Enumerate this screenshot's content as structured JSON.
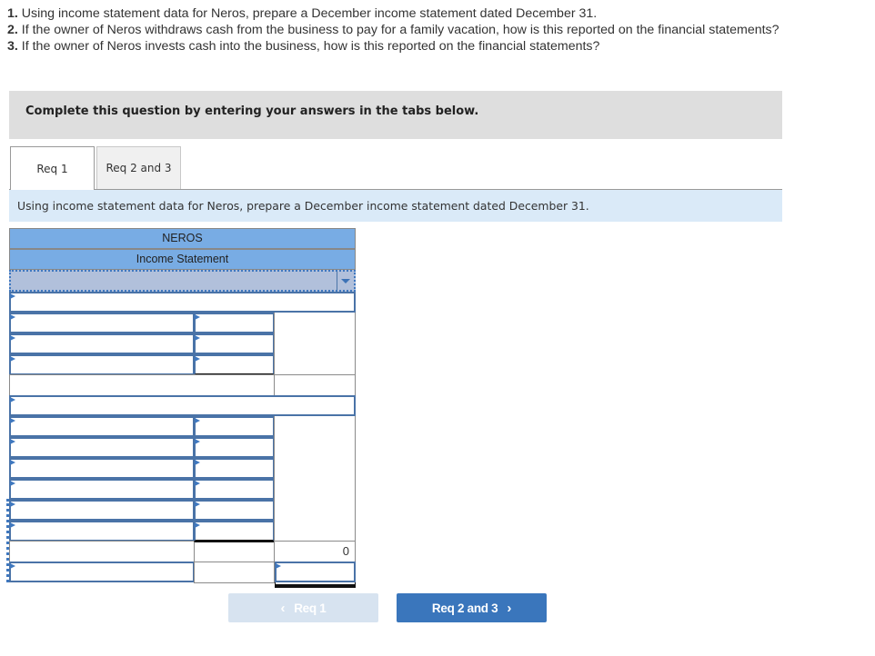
{
  "questions": [
    {
      "num": "1.",
      "text": " Using income statement data for Neros, prepare a December income statement dated December 31."
    },
    {
      "num": "2.",
      "text": " If the owner of Neros withdraws cash from the business to pay for a family vacation, how is this reported on the financial statements?"
    },
    {
      "num": "3.",
      "text": " If the owner of Neros invests cash into the business, how is this reported on the financial statements?"
    }
  ],
  "banner": {
    "text": "Complete this question by entering your answers in the tabs below."
  },
  "tabs": [
    {
      "label": "Req 1",
      "active": true
    },
    {
      "label": "Req 2 and 3",
      "active": false
    }
  ],
  "instruction": "Using income statement data for Neros, prepare a December income statement dated December 31.",
  "statement": {
    "company": "NEROS",
    "title": "Income Statement",
    "date_dropdown": {
      "selected": "",
      "options_visible": false
    },
    "total_value": "0"
  },
  "nav": {
    "prev": {
      "label": "Req 1",
      "icon": "chevron-left-icon",
      "glyph": "‹",
      "disabled": true
    },
    "next": {
      "label": "Req 2 and 3",
      "icon": "chevron-right-icon",
      "glyph": "›",
      "disabled": false
    }
  },
  "colors": {
    "header_blue": "#78ace4",
    "button_blue": "#3a76bc",
    "button_disabled": "#d7e3f0",
    "instruction_bg": "#daeaf8",
    "banner_bg": "#dedede",
    "input_border": "#4a73a7"
  }
}
